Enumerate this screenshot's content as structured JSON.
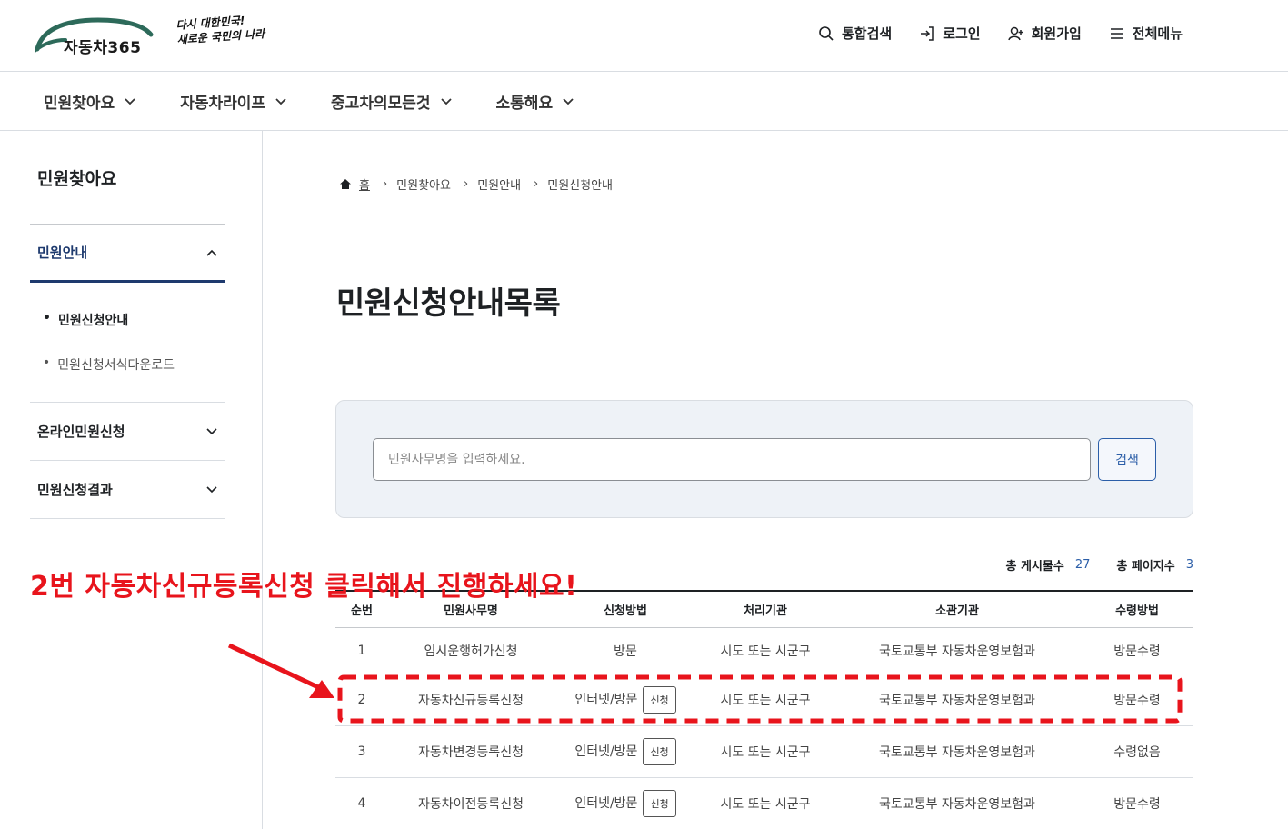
{
  "header": {
    "logo_text": "자동차365",
    "slogan_line1": "다시 대한민국!",
    "slogan_line2": "새로운 국민의 나라",
    "util": [
      {
        "label": "통합검색",
        "icon": "search-icon"
      },
      {
        "label": "로그인",
        "icon": "login-icon"
      },
      {
        "label": "회원가입",
        "icon": "user-add-icon"
      },
      {
        "label": "전체메뉴",
        "icon": "menu-icon"
      }
    ]
  },
  "gnb": [
    "민원찾아요",
    "자동차라이프",
    "중고차의모든것",
    "소통해요"
  ],
  "sidebar": {
    "title": "민원찾아요",
    "open_section": "민원안내",
    "sub_items": [
      "민원신청안내",
      "민원신청서식다운로드"
    ],
    "closed_sections": [
      "온라인민원신청",
      "민원신청결과"
    ]
  },
  "breadcrumb": [
    "홈",
    "민원찾아요",
    "민원안내",
    "민원신청안내"
  ],
  "page_title": "민원신청안내목록",
  "search": {
    "placeholder": "민원사무명을 입력하세요.",
    "button": "검색"
  },
  "counts": {
    "total_label": "총 게시물수",
    "total": "27",
    "pages_label": "총 페이지수",
    "pages": "3"
  },
  "table": {
    "headers": [
      "순번",
      "민원사무명",
      "신청방법",
      "처리기관",
      "소관기관",
      "수령방법"
    ],
    "apply_label": "신청",
    "rows": [
      {
        "no": "1",
        "name": "임시운행허가신청",
        "method": "방문",
        "proc": "시도 또는 시군구",
        "org": "국토교통부 자동차운영보험과",
        "receive": "방문수령"
      },
      {
        "no": "2",
        "name": "자동차신규등록신청",
        "method": "인터넷/방문",
        "proc": "시도 또는 시군구",
        "org": "국토교통부 자동차운영보험과",
        "receive": "방문수령"
      },
      {
        "no": "3",
        "name": "자동차변경등록신청",
        "method": "인터넷/방문",
        "proc": "시도 또는 시군구",
        "org": "국토교통부 자동차운영보험과",
        "receive": "수령없음"
      },
      {
        "no": "4",
        "name": "자동차이전등록신청",
        "method": "인터넷/방문",
        "proc": "시도 또는 시군구",
        "org": "국토교통부 자동차운영보험과",
        "receive": "방문수령"
      }
    ]
  },
  "annotation": {
    "text": "2번 자동차신규등록신청 클릭해서 진행하세요!",
    "color": "#e8141c"
  },
  "colors": {
    "accent": "#1e3a6e",
    "link": "#2b5ea8",
    "search_bg": "#eef2f7"
  }
}
